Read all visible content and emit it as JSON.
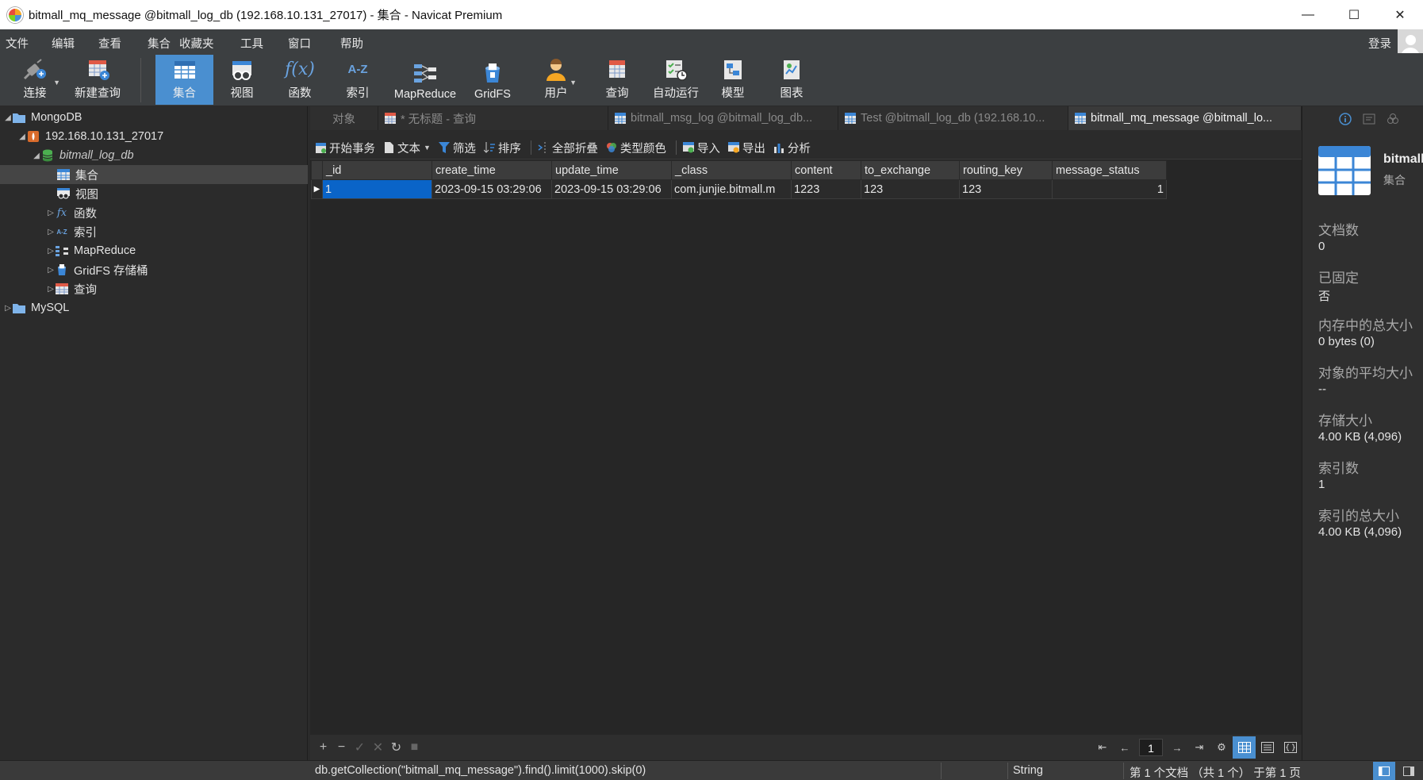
{
  "window": {
    "title": "bitmall_mq_message @bitmall_log_db (192.168.10.131_27017) - 集合 - Navicat Premium",
    "minimize": "—",
    "maximize": "☐",
    "close": "✕"
  },
  "menu": {
    "items": [
      "文件",
      "编辑",
      "查看",
      "集合",
      "收藏夹",
      "工具",
      "窗口",
      "帮助"
    ],
    "login": "登录"
  },
  "toolbar": {
    "connect": "连接",
    "new_query": "新建查询",
    "collection": "集合",
    "view": "视图",
    "function": "函数",
    "index": "索引",
    "mapreduce": "MapReduce",
    "gridfs": "GridFS",
    "user": "用户",
    "query": "查询",
    "automation": "自动运行",
    "model": "模型",
    "chart": "图表",
    "function_icon_text": "f(x)",
    "index_icon_text": "A-Z"
  },
  "tree": {
    "mongodb": "MongoDB",
    "server": "192.168.10.131_27017",
    "database": "bitmall_log_db",
    "collection": "集合",
    "view": "视图",
    "function": "函数",
    "index": "索引",
    "mapreduce": "MapReduce",
    "gridfs": "GridFS 存储桶",
    "query": "查询",
    "mysql": "MySQL",
    "function_icon_text": "fx",
    "index_icon_text": "A-Z"
  },
  "tabs": {
    "objects": "对象",
    "untitled": "* 无标题 - 查询",
    "msg_log": "bitmall_msg_log @bitmall_log_db...",
    "test": "Test @bitmall_log_db (192.168.10...",
    "mq_message": "bitmall_mq_message @bitmall_lo..."
  },
  "subtoolbar": {
    "begin_tx": "开始事务",
    "text": "文本",
    "filter": "筛选",
    "sort": "排序",
    "collapse_all": "全部折叠",
    "type_color": "类型颜色",
    "import": "导入",
    "export": "导出",
    "analyze": "分析"
  },
  "grid": {
    "columns": [
      "_id",
      "create_time",
      "update_time",
      "_class",
      "content",
      "to_exchange",
      "routing_key",
      "message_status"
    ],
    "rows": [
      [
        "1",
        "2023-09-15 03:29:06",
        "2023-09-15 03:29:06",
        "com.junjie.bitmall.m",
        "1223",
        "123",
        "123",
        "1"
      ]
    ]
  },
  "bottombar": {
    "add": "+",
    "remove": "−",
    "apply": "✓",
    "discard": "✕",
    "refresh": "↻",
    "stop": "■",
    "first": "⇤",
    "prev": "←",
    "page": "1",
    "next": "→",
    "last": "⇥",
    "settings": "⚙"
  },
  "info": {
    "name": "bitmall_mq_message",
    "type": "集合",
    "doc_count_label": "文档数",
    "doc_count": "0",
    "capped_label": "已固定",
    "capped": "否",
    "mem_size_label": "内存中的总大小",
    "mem_size": "0 bytes (0)",
    "avg_size_label": "对象的平均大小",
    "avg_size": "--",
    "storage_label": "存储大小",
    "storage": "4.00 KB (4,096)",
    "index_count_label": "索引数",
    "index_count": "1",
    "index_size_label": "索引的总大小",
    "index_size": "4.00 KB (4,096)"
  },
  "status": {
    "query": "db.getCollection(\"bitmall_mq_message\").find().limit(1000).skip(0)",
    "type": "String",
    "count": "第 1 个文档 （共 1 个） 于第 1 页"
  },
  "colors": {
    "accent": "#4a8fd0",
    "selection": "#0a64c8"
  }
}
